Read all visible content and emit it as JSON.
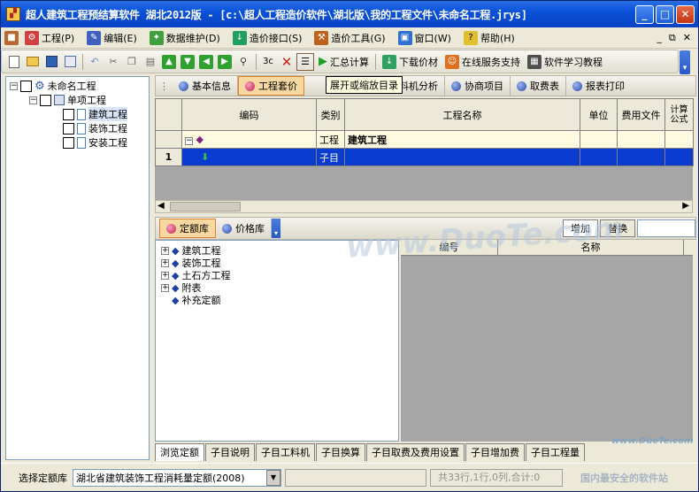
{
  "title": "超人建筑工程预结算软件 湖北2012版 - [c:\\超人工程造价软件\\湖北版\\我的工程文件\\未命名工程.jrys]",
  "menu": [
    {
      "label": "工程(P)",
      "icon": "engineering-icon",
      "color": "#d04040"
    },
    {
      "label": "编辑(E)",
      "icon": "edit-icon",
      "color": "#4060c0"
    },
    {
      "label": "数据维护(D)",
      "icon": "data-maintenance-icon",
      "color": "#40a040"
    },
    {
      "label": "造价接口(S)",
      "icon": "cost-interface-icon",
      "color": "#20a060"
    },
    {
      "label": "造价工具(G)",
      "icon": "cost-tools-icon",
      "color": "#c06020"
    },
    {
      "label": "窗口(W)",
      "icon": "window-icon",
      "color": "#3070d0"
    },
    {
      "label": "帮助(H)",
      "icon": "help-icon",
      "color": "#e0c030"
    }
  ],
  "mdi_controls": [
    "_",
    "⧉",
    "✕"
  ],
  "toolbar": {
    "summary_label": "汇总计算",
    "download_label": "下载价材",
    "service_label": "在线服务支持",
    "learn_label": "软件学习教程"
  },
  "tree": {
    "root": "未命名工程",
    "single": "单项工程",
    "items": [
      "建筑工程",
      "装饰工程",
      "安装工程"
    ]
  },
  "tabs": [
    {
      "label": "基本信息",
      "active": false
    },
    {
      "label": "工程套价",
      "active": true
    },
    {
      "label": "工料机分析",
      "active": false
    },
    {
      "label": "协商项目",
      "active": false
    },
    {
      "label": "取费表",
      "active": false
    },
    {
      "label": "报表打印",
      "active": false
    }
  ],
  "tooltip": "展开或缩放目录",
  "grid": {
    "headers": [
      "",
      "编码",
      "类别",
      "工程名称",
      "单位",
      "费用文件",
      "计算公式"
    ],
    "rows": [
      {
        "num": "",
        "code": "",
        "type": "工程",
        "name": "建筑工程"
      },
      {
        "num": "1",
        "code": "",
        "type": "子目",
        "name": ""
      }
    ]
  },
  "lower_tabs": {
    "quota_label": "定额库",
    "price_label": "价格库"
  },
  "lower_buttons": {
    "add": "增加",
    "replace": "替换"
  },
  "lower_tree": [
    "建筑工程",
    "装饰工程",
    "土石方工程",
    "附表",
    "补充定额"
  ],
  "lower_grid_headers": {
    "num": "编号",
    "name": "名称"
  },
  "bottom_tabs": [
    "浏览定额",
    "子目说明",
    "子目工料机",
    "子目换算",
    "子目取费及费用设置",
    "子目增加费",
    "子目工程量"
  ],
  "status": {
    "select_label": "选择定额库",
    "library": "湖北省建筑装饰工程消耗量定额(2008)",
    "summary": "共33行,1行,0列,合计:0",
    "safe_text": "国内最安全的软件站"
  },
  "watermark": "www.DuoTe.com",
  "watermark_small": "www.DuoTe.com"
}
